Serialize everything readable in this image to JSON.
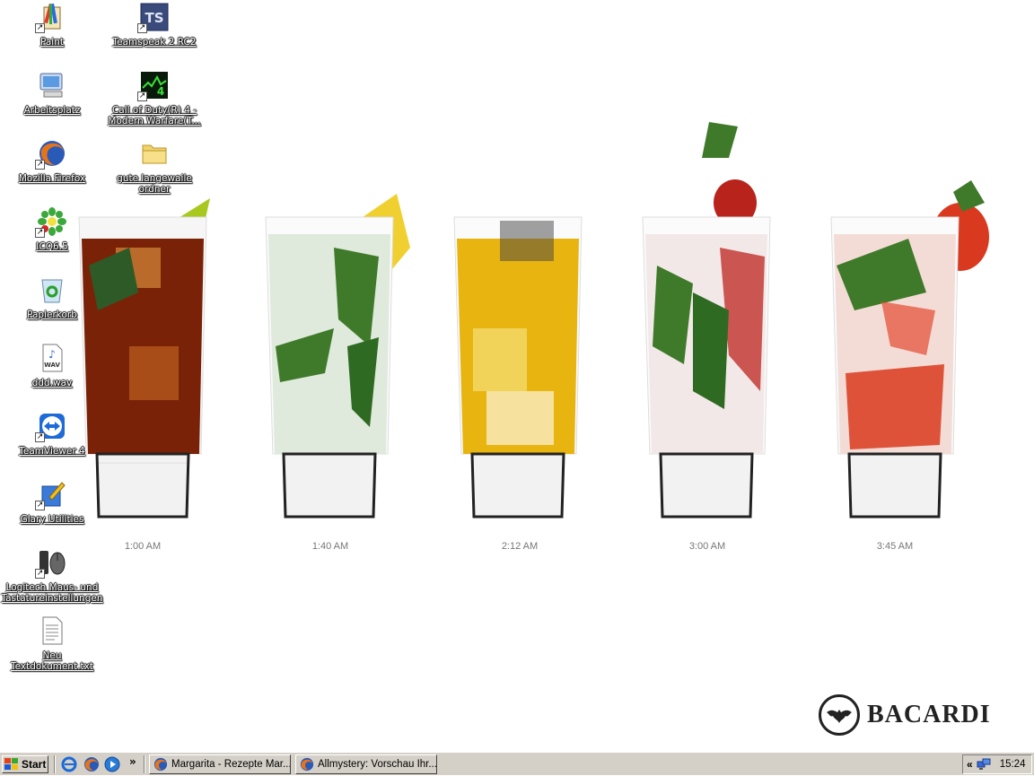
{
  "desktop": {
    "icons": [
      {
        "label": "Paint",
        "icon": "paint-icon"
      },
      {
        "label": "Teamspeak 2 RC2",
        "icon": "teamspeak-icon"
      },
      {
        "label": "Arbeitsplatz",
        "icon": "computer-icon"
      },
      {
        "label": "Call of Duty(R) 4 -",
        "label2": "Modern Warfare(T...",
        "icon": "call-of-duty-icon"
      },
      {
        "label": "Mozilla Firefox",
        "icon": "firefox-icon"
      },
      {
        "label": "gute langewaile ordner",
        "icon": "folder-icon"
      },
      {
        "label": "ICQ6.5",
        "icon": "icq-icon"
      },
      {
        "label": "Papierkorb",
        "icon": "recycle-bin-icon"
      },
      {
        "label": "ddd.wav",
        "icon": "wav-file-icon"
      },
      {
        "label": "TeamViewer 4",
        "icon": "teamviewer-icon"
      },
      {
        "label": "Glary Utilities",
        "icon": "glary-utilities-icon"
      },
      {
        "label": "Logitech Maus- und",
        "label2": "Tastatureinstellungen",
        "icon": "logitech-icon"
      },
      {
        "label": "Neu Textdokument.txt",
        "icon": "text-file-icon"
      }
    ]
  },
  "wallpaper": {
    "times": [
      "1:00 AM",
      "1:40 AM",
      "2:12 AM",
      "3:00 AM",
      "3:45 AM"
    ],
    "brand": "BACARDI",
    "colors": {
      "cola": "#7a2208",
      "mojito": "#dfe9dc",
      "gold": "#e8b410",
      "raspberry": "#b8231c",
      "strawberry": "#d9391f",
      "leaf": "#3f7a2a"
    }
  },
  "taskbar": {
    "start_label": "Start",
    "quick_launch": [
      "ie-icon",
      "firefox-icon",
      "media-player-icon"
    ],
    "overflow": "»",
    "tasks": [
      {
        "label": "Margarita - Rezepte Mar...",
        "icon": "firefox-icon"
      },
      {
        "label": "Allmystery: Vorschau Ihr...",
        "icon": "firefox-icon"
      }
    ],
    "tray": {
      "chevron": "«",
      "clock": "15:24"
    }
  }
}
